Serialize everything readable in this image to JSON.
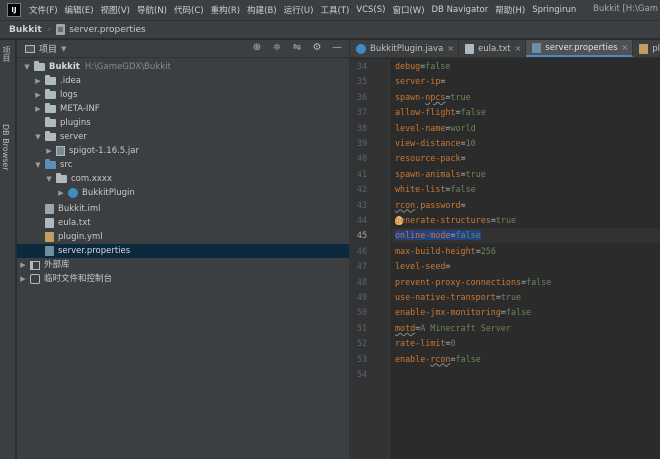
{
  "menubar": {
    "items": [
      "文件(F)",
      "编辑(E)",
      "视图(V)",
      "导航(N)",
      "代码(C)",
      "重构(R)",
      "构建(B)",
      "运行(U)",
      "工具(T)",
      "VCS(S)",
      "窗口(W)",
      "DB Navigator",
      "帮助(H)",
      "Springirun"
    ],
    "window_title": "Bukkit [H:\\Gam"
  },
  "breadcrumb": {
    "project": "Bukkit",
    "file": "server.properties"
  },
  "left_strip": {
    "project_tab": "项目",
    "db_tab": "DB Browser"
  },
  "project_panel": {
    "title": "项目",
    "tree": [
      {
        "label": "Bukkit",
        "path": "H:\\GameGDX\\Bukkit"
      },
      {
        "label": ".idea"
      },
      {
        "label": "logs"
      },
      {
        "label": "META-INF"
      },
      {
        "label": "plugins"
      },
      {
        "label": "server"
      },
      {
        "label": "spigot-1.16.5.jar"
      },
      {
        "label": "src"
      },
      {
        "label": "com.xxxx"
      },
      {
        "label": "BukkitPlugin"
      },
      {
        "label": "Bukkit.iml"
      },
      {
        "label": "eula.txt"
      },
      {
        "label": "plugin.yml"
      },
      {
        "label": "server.properties"
      },
      {
        "label": "外部库"
      },
      {
        "label": "临时文件和控制台"
      }
    ]
  },
  "editor": {
    "tabs": [
      {
        "label": "BukkitPlugin.java"
      },
      {
        "label": "eula.txt"
      },
      {
        "label": "server.properties"
      },
      {
        "label": "plugi"
      }
    ],
    "lines": [
      {
        "num": "34",
        "key": "debug",
        "value": "false"
      },
      {
        "num": "35",
        "key": "server-ip",
        "value": ""
      },
      {
        "num": "36",
        "key": "spawn-npcs",
        "value": "true"
      },
      {
        "num": "37",
        "key": "allow-flight",
        "value": "false"
      },
      {
        "num": "38",
        "key": "level-name",
        "value": "world"
      },
      {
        "num": "39",
        "key": "view-distance",
        "value": "10"
      },
      {
        "num": "40",
        "key": "resource-pack",
        "value": ""
      },
      {
        "num": "41",
        "key": "spawn-animals",
        "value": "true"
      },
      {
        "num": "42",
        "key": "white-list",
        "value": "false"
      },
      {
        "num": "43",
        "key": "rcon.password",
        "value": ""
      },
      {
        "num": "44",
        "key": "generate-structures",
        "value": "true"
      },
      {
        "num": "45",
        "key": "online-mode",
        "value": "false"
      },
      {
        "num": "46",
        "key": "max-build-height",
        "value": "256"
      },
      {
        "num": "47",
        "key": "level-seed",
        "value": ""
      },
      {
        "num": "48",
        "key": "prevent-proxy-connections",
        "value": "false"
      },
      {
        "num": "49",
        "key": "use-native-transport",
        "value": "true"
      },
      {
        "num": "50",
        "key": "enable-jmx-monitoring",
        "value": "false"
      },
      {
        "num": "51",
        "key": "motd",
        "value": "A Minecraft Server"
      },
      {
        "num": "52",
        "key": "rate-limit",
        "value": "0"
      },
      {
        "num": "53",
        "key": "enable-rcon",
        "value": "false"
      },
      {
        "num": "54",
        "key": "",
        "value": ""
      }
    ]
  },
  "colors": {
    "key": "#cc7832",
    "value": "#6a8759",
    "selection": "#214283",
    "tree_selection": "#0d293e",
    "active_tab_underline": "#4a88c7"
  }
}
